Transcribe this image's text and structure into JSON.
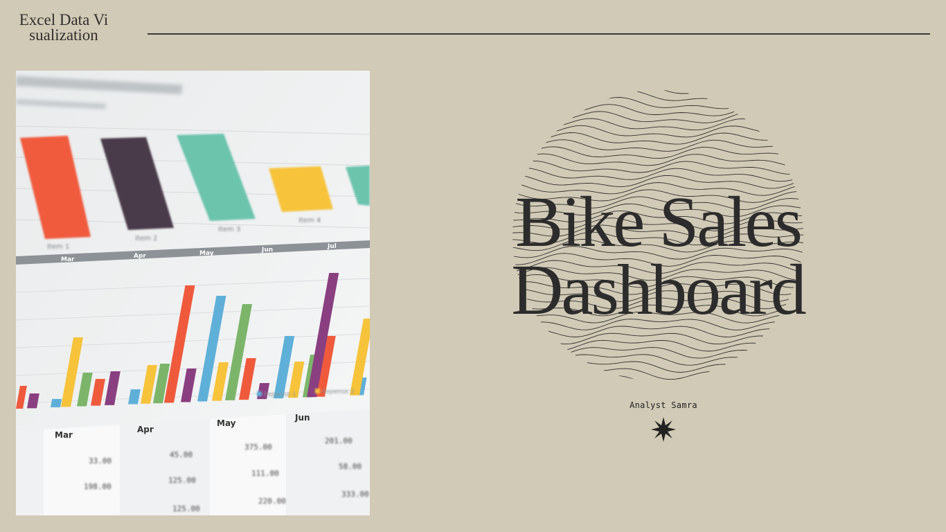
{
  "header": {
    "corner_title": "Excel Data Visualization"
  },
  "main": {
    "title_line1": "Bike Sales",
    "title_line2": "Dashboard",
    "author": "Analyst Samra"
  },
  "photo": {
    "month_labels": [
      "Mar",
      "Apr",
      "May",
      "Jun",
      "Jul"
    ],
    "table_months": [
      "Mar",
      "Apr",
      "May",
      "Jun"
    ],
    "legend": [
      "Expense 1",
      "Expense 2"
    ],
    "item_labels": [
      "Item 1",
      "Item 2",
      "Item 3",
      "Item 4"
    ],
    "table_values": [
      "33.00",
      "45.00",
      "375.00",
      "201.00",
      "198.00",
      "125.00",
      "111.00",
      "58.00",
      "220.00",
      "333.00",
      "125.00"
    ]
  },
  "colors": {
    "background": "#d1cab6",
    "text": "#2c2c2c",
    "bar_red": "#f05a3c",
    "bar_purple": "#4a3a48",
    "bar_teal": "#6cc4ad",
    "bar_yellow": "#f6c33a",
    "bar_blue": "#5fb0d8",
    "bar_green": "#7cb56a",
    "bar_violet": "#8a3f80"
  },
  "icons": {
    "star": "eight-point-star-icon"
  }
}
